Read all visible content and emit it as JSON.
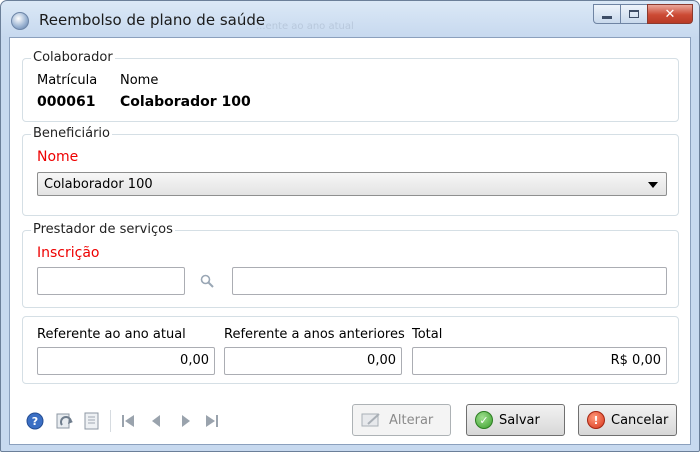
{
  "window": {
    "title": "Reembolso de plano de saúde",
    "ghost_text": "...ente ao ano atual"
  },
  "colaborador": {
    "legend": "Colaborador",
    "matricula_label": "Matrícula",
    "nome_label": "Nome",
    "matricula_value": "000061",
    "nome_value": "Colaborador 100"
  },
  "beneficiario": {
    "legend": "Beneficiário",
    "nome_label": "Nome",
    "selected": "Colaborador 100"
  },
  "prestador": {
    "legend": "Prestador de serviços",
    "inscricao_label": "Inscrição",
    "inscricao_value": "",
    "nome_value": ""
  },
  "valores": {
    "ano_atual_label": "Referente ao ano atual",
    "anos_anteriores_label": "Referente a anos anteriores",
    "total_label": "Total",
    "ano_atual_value": "0,00",
    "anos_anteriores_value": "0,00",
    "total_value": "R$ 0,00"
  },
  "toolbar": {
    "alterar_label": "Alterar",
    "salvar_label": "Salvar",
    "cancelar_label": "Cancelar",
    "icons": [
      "help-icon",
      "refresh-icon",
      "document-icon",
      "first-record-icon",
      "previous-record-icon",
      "next-record-icon",
      "last-record-icon"
    ]
  },
  "colors": {
    "required_label": "#e00000",
    "group_border": "#d5dfe5",
    "title_bar": "#c7d9ef",
    "close_button": "#cc4a34"
  }
}
